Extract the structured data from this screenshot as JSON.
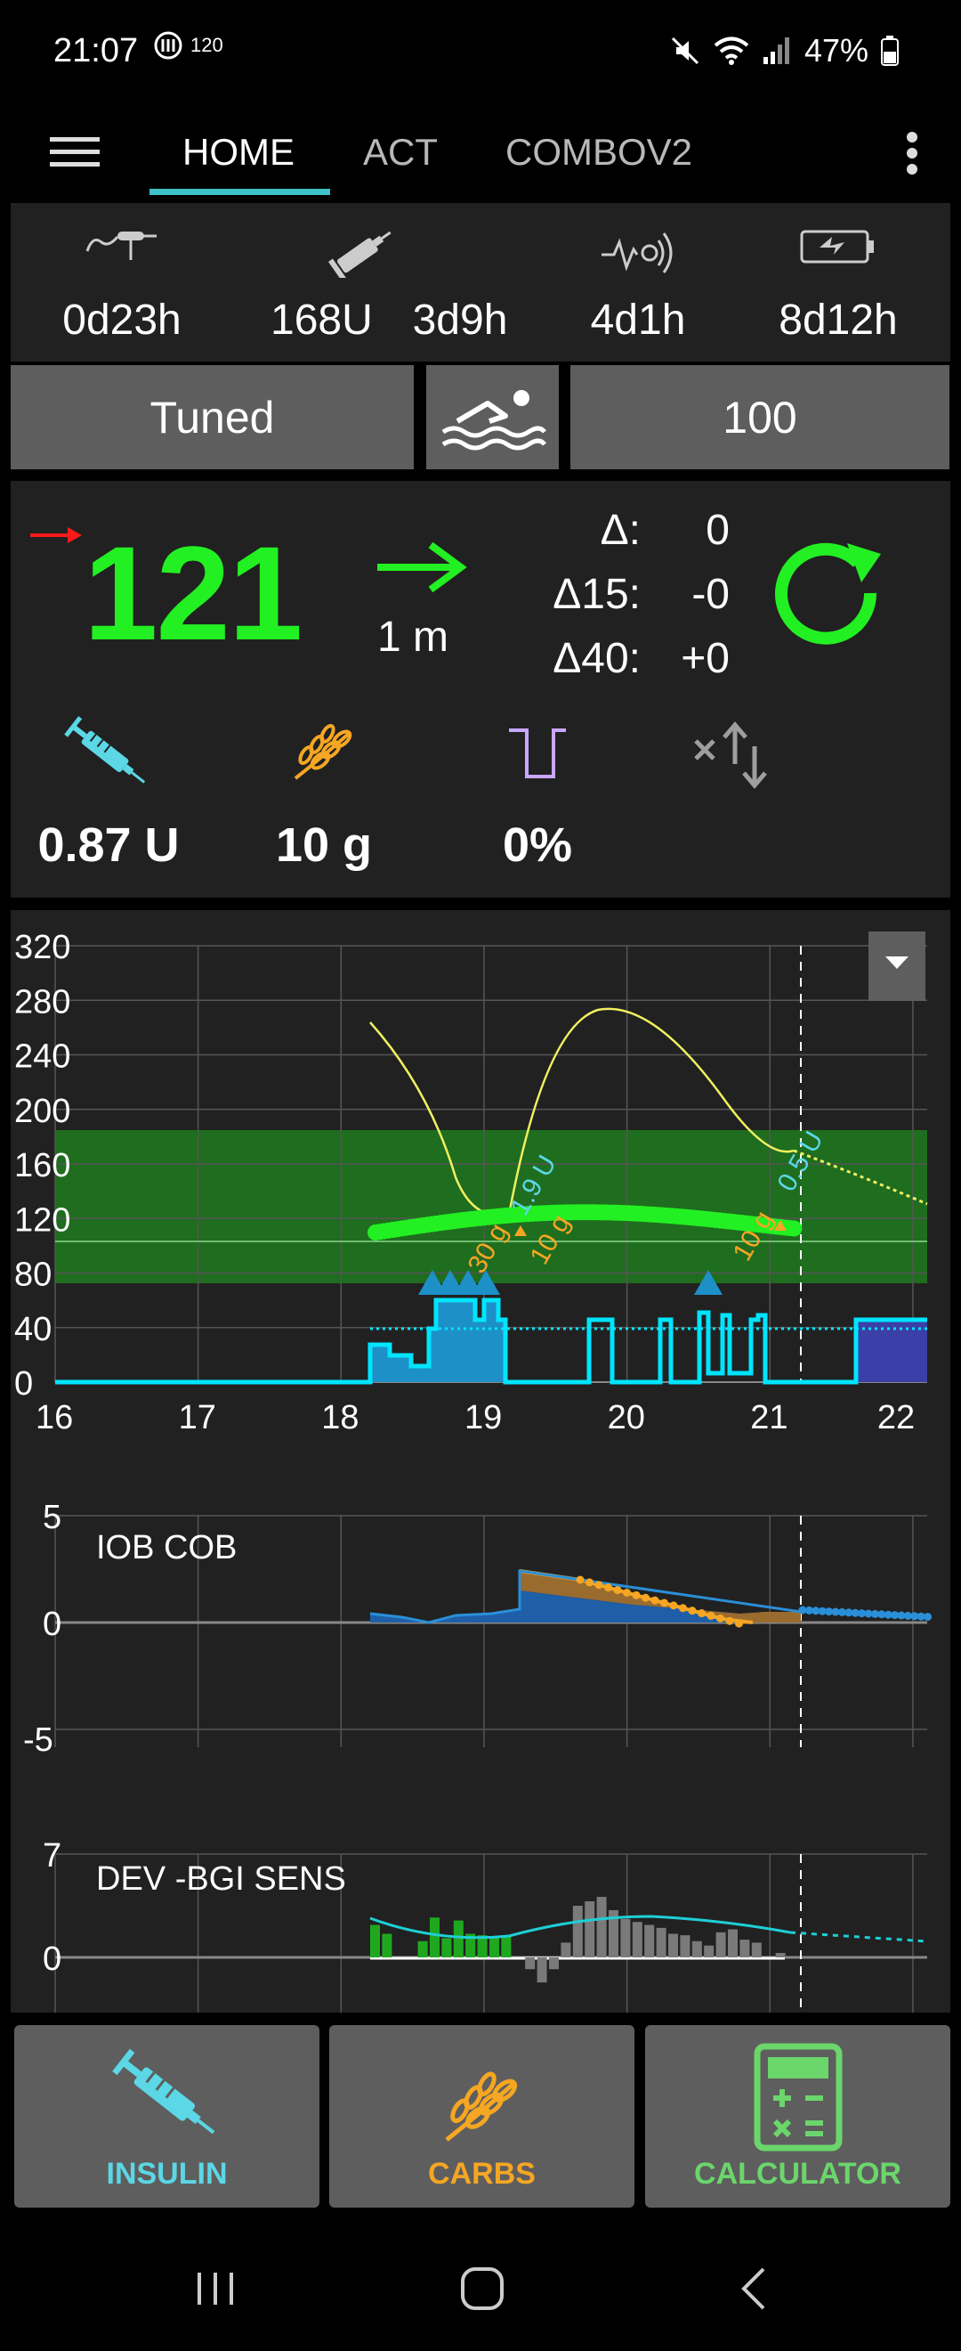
{
  "status_bar": {
    "time": "21:07",
    "refresh_rate": "120",
    "battery": "47%"
  },
  "tabs": [
    {
      "label": "HOME",
      "active": true
    },
    {
      "label": "ACT",
      "active": false
    },
    {
      "label": "COMBOV2",
      "active": false
    }
  ],
  "device_status": {
    "cannula_age": "0d23h",
    "reservoir": "168U",
    "insulin_age": "3d9h",
    "sensor_age": "4d1h",
    "battery_age": "8d12h"
  },
  "profile_button": "Tuned",
  "target_button": "100",
  "bg": {
    "value": "121",
    "time_ago": "1 m",
    "delta_label": "Δ:",
    "delta": "0",
    "delta15_label": "Δ15:",
    "delta15": "-0",
    "delta40_label": "Δ40:",
    "delta40": "+0",
    "iob": "0.87 U",
    "cob": "10 g",
    "temp_basal": "0%"
  },
  "colors": {
    "bg_value": "#22f022",
    "insulin": "#5bd7e6",
    "carbs": "#f5a623",
    "calculator": "#6bd66b",
    "basal": "#00e5ff",
    "target_band": "#1f6d1f",
    "temp_target": "#c9a6ff"
  },
  "chart_data": [
    {
      "type": "line",
      "y_ticks": [
        "320",
        "280",
        "240",
        "200",
        "160",
        "120",
        "80",
        "40",
        "0"
      ],
      "x_ticks": [
        "16",
        "17",
        "18",
        "19",
        "20",
        "21",
        "22"
      ],
      "ylim": [
        0,
        320
      ],
      "xlim": [
        16,
        22.1
      ],
      "target_range": [
        70,
        180
      ],
      "annotations": [
        "1.9 U",
        "30 g",
        "10 g",
        "10 g",
        "0.5 U"
      ]
    },
    {
      "type": "area",
      "title": "IOB COB",
      "y_ticks": [
        "5",
        "0",
        "-5"
      ],
      "ylim": [
        -5,
        5
      ]
    },
    {
      "type": "bar",
      "title": "DEV -BGI SENS",
      "y_ticks": [
        "7",
        "0"
      ],
      "ylim": [
        -3,
        7
      ]
    }
  ],
  "actions": [
    {
      "label": "INSULIN",
      "icon": "syringe-icon"
    },
    {
      "label": "CARBS",
      "icon": "wheat-icon"
    },
    {
      "label": "CALCULATOR",
      "icon": "calculator-icon"
    }
  ]
}
